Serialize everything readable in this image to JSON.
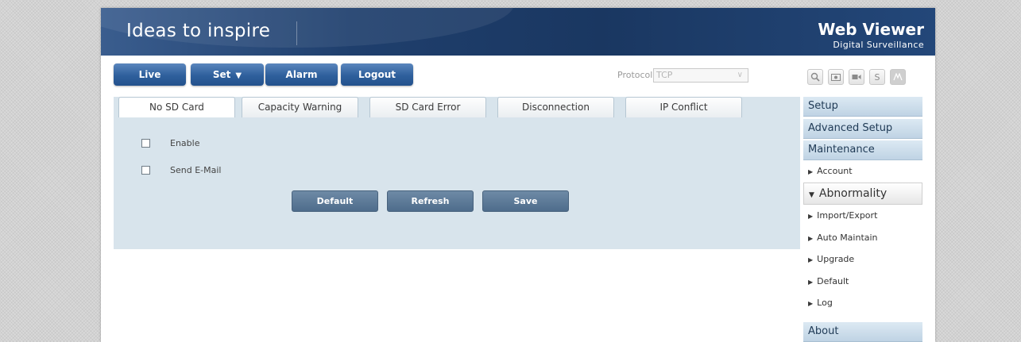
{
  "header": {
    "slogan": "Ideas to inspire",
    "product_name": "Web Viewer",
    "product_subtitle": "Digital Surveillance"
  },
  "topnav": {
    "items": [
      {
        "label": "Live"
      },
      {
        "label": "Set",
        "dropdown": true
      },
      {
        "label": "Alarm"
      },
      {
        "label": "Logout"
      }
    ]
  },
  "protocol": {
    "label": "Protocol",
    "value": "TCP"
  },
  "toolbar_icons": [
    "search-icon",
    "snapshot-icon",
    "record-icon",
    "s-icon",
    "fullscreen-icon"
  ],
  "tabs": [
    {
      "label": "No SD Card",
      "active": true
    },
    {
      "label": "Capacity Warning"
    },
    {
      "label": "SD Card Error"
    },
    {
      "label": "Disconnection"
    },
    {
      "label": "IP Conflict"
    }
  ],
  "form": {
    "enable_label": "Enable",
    "send_email_label": "Send E-Mail",
    "enable_checked": false,
    "send_email_checked": false
  },
  "actions": {
    "default": "Default",
    "refresh": "Refresh",
    "save": "Save"
  },
  "sidebar": {
    "setup": "Setup",
    "advanced_setup": "Advanced Setup",
    "maintenance": "Maintenance",
    "account": "Account",
    "abnormality": "Abnormality",
    "import_export": "Import/Export",
    "auto_maintain": "Auto Maintain",
    "upgrade": "Upgrade",
    "default": "Default",
    "log": "Log",
    "about": "About"
  },
  "colors": {
    "header_bg": "#1f3f6d",
    "nav_button": "#2e5f9c",
    "content_bg": "#d8e4ec",
    "action_button": "#5a7898"
  }
}
